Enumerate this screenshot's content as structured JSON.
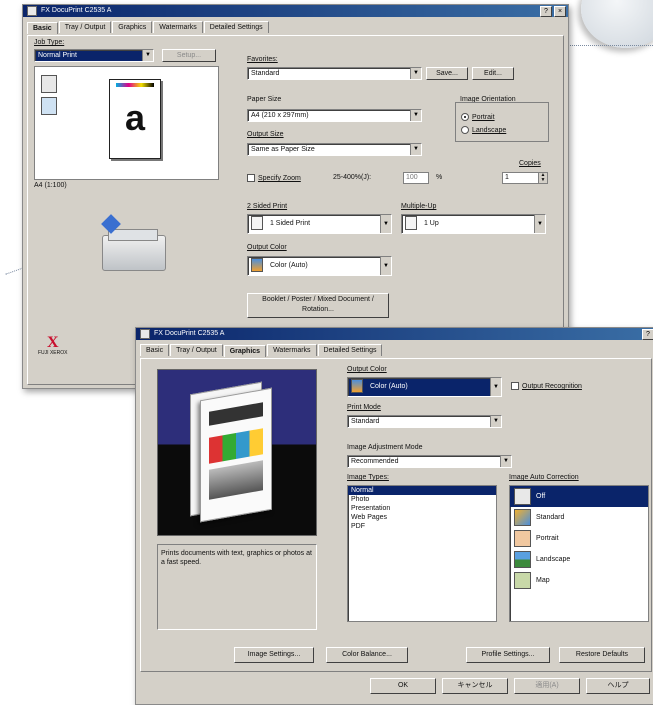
{
  "window1": {
    "title": "FX DocuPrint C2535 A",
    "title_buttons": [
      "?",
      "×"
    ],
    "tabs": [
      "Basic",
      "Tray / Output",
      "Graphics",
      "Watermarks",
      "Detailed Settings"
    ],
    "active_tab": "Basic",
    "job_type_label": "Job Type:",
    "job_type_value": "Normal Print",
    "job_type_setup": "Setup...",
    "paper_preview_letter": "a",
    "paper_caption": "A4 (1:100)",
    "favorites_label": "Favorites:",
    "favorites_value": "Standard",
    "save_label": "Save...",
    "edit_label": "Edit...",
    "paper_size_label": "Paper Size",
    "paper_size_value": "A4 (210 x 297mm)",
    "image_orientation_label": "Image Orientation",
    "orientation_portrait": "Portrait",
    "orientation_landscape": "Landscape",
    "output_size_label": "Output Size",
    "output_size_value": "Same as Paper Size",
    "copies_label": "Copies",
    "copies_value": "1",
    "specify_zoom_label": "Specify Zoom",
    "zoom_range": "25-400%(J):",
    "zoom_value": "100",
    "zoom_unit": "%",
    "two_sided_label": "2 Sided Print",
    "two_sided_value": "1 Sided Print",
    "multiple_up_label": "Multiple-Up",
    "multiple_up_value": "1 Up",
    "output_color_label": "Output Color",
    "output_color_value": "Color (Auto)",
    "booklet_button": "Booklet / Poster / Mixed Document / Rotation...",
    "brand_mark": "X",
    "brand_text": "FUJI XEROX"
  },
  "window2": {
    "title": "FX DocuPrint C2535 A",
    "title_buttons": [
      "?"
    ],
    "tabs": [
      "Basic",
      "Tray / Output",
      "Graphics",
      "Watermarks",
      "Detailed Settings"
    ],
    "active_tab": "Graphics",
    "output_color_label": "Output Color",
    "output_color_value": "Color (Auto)",
    "output_recognition_label": "Output Recognition",
    "print_mode_label": "Print Mode",
    "print_mode_value": "Standard",
    "image_adjustment_label": "Image Adjustment Mode",
    "image_adjustment_value": "Recommended",
    "image_types_label": "Image Types:",
    "image_types": [
      "Normal",
      "Photo",
      "Presentation",
      "Web Pages",
      "PDF"
    ],
    "image_types_selected": "Normal",
    "auto_correction_label": "Image Auto Correction",
    "auto_correction_items": [
      "Off",
      "Standard",
      "Portrait",
      "Landscape",
      "Map"
    ],
    "auto_correction_selected": "Off",
    "description_text": "Prints documents with text, graphics or photos at a fast speed.",
    "image_settings_button": "Image Settings...",
    "color_balance_button": "Color Balance...",
    "profile_settings_button": "Profile Settings...",
    "restore_defaults_button": "Restore Defaults",
    "ok_button": "OK",
    "cancel_button": "キャンセル",
    "apply_button": "適用(A)",
    "help_button": "ヘルプ"
  },
  "colors": {
    "window_face": "#d4d0c8",
    "title_bar": "#0a246a",
    "selection": "#0a246a",
    "preview_bg": "#2d2e7a",
    "brand_red": "#c8102e"
  }
}
